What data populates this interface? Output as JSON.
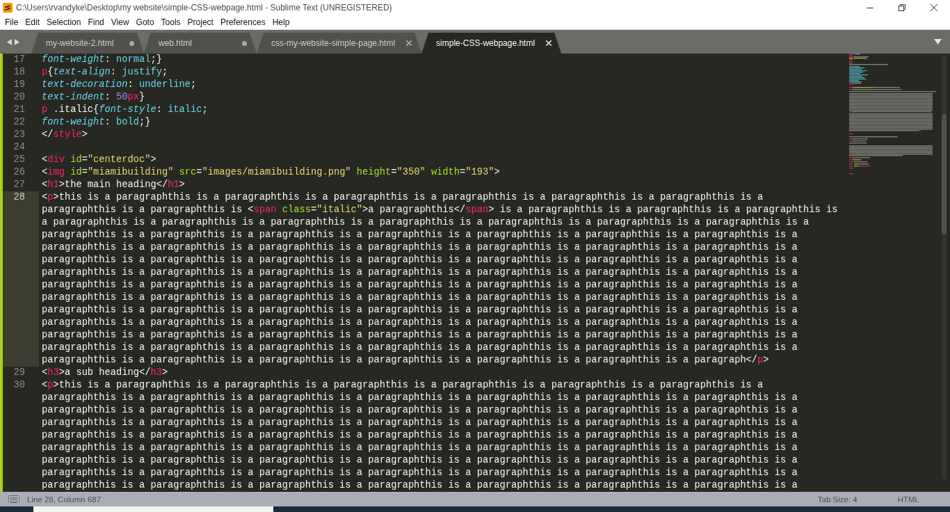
{
  "window": {
    "title": "C:\\Users\\rvandyke\\Desktop\\my website\\simple-CSS-webpage.html - Sublime Text (UNREGISTERED)"
  },
  "menu": [
    "File",
    "Edit",
    "Selection",
    "Find",
    "View",
    "Goto",
    "Tools",
    "Project",
    "Preferences",
    "Help"
  ],
  "tabs": [
    {
      "label": "my-website-2.html",
      "selected": false,
      "modified": true
    },
    {
      "label": "web.html",
      "selected": false,
      "modified": true
    },
    {
      "label": "css-my-website-simple-page.html",
      "selected": false,
      "modified": false
    },
    {
      "label": "simple-CSS-webpage.html",
      "selected": true,
      "modified": false
    }
  ],
  "editor": {
    "lines": [
      {
        "number": "17",
        "current": false,
        "wrapped": [
          {
            "spans": [
              {
                "kind": "property",
                "text": "font-weight"
              },
              {
                "kind": "plain",
                "text": ": "
              },
              {
                "kind": "value",
                "text": "normal"
              },
              {
                "kind": "plain",
                "text": ";}"
              }
            ]
          }
        ]
      },
      {
        "number": "18",
        "current": false,
        "wrapped": [
          {
            "spans": [
              {
                "kind": "tag",
                "text": "p"
              },
              {
                "kind": "plain",
                "text": "{"
              },
              {
                "kind": "property",
                "text": "text-align"
              },
              {
                "kind": "plain",
                "text": ": "
              },
              {
                "kind": "value",
                "text": "justify"
              },
              {
                "kind": "plain",
                "text": ";"
              }
            ]
          }
        ]
      },
      {
        "number": "19",
        "current": false,
        "wrapped": [
          {
            "spans": [
              {
                "kind": "property",
                "text": "text-decoration"
              },
              {
                "kind": "plain",
                "text": ": "
              },
              {
                "kind": "value",
                "text": "underline"
              },
              {
                "kind": "plain",
                "text": ";"
              }
            ]
          }
        ]
      },
      {
        "number": "20",
        "current": false,
        "wrapped": [
          {
            "spans": [
              {
                "kind": "property",
                "text": "text-indent"
              },
              {
                "kind": "plain",
                "text": ": "
              },
              {
                "kind": "number",
                "text": "50"
              },
              {
                "kind": "unit",
                "text": "px"
              },
              {
                "kind": "plain",
                "text": "}"
              }
            ]
          }
        ]
      },
      {
        "number": "21",
        "current": false,
        "wrapped": [
          {
            "spans": [
              {
                "kind": "tag",
                "text": "p"
              },
              {
                "kind": "plain",
                "text": " .italic{"
              },
              {
                "kind": "property",
                "text": "font-style"
              },
              {
                "kind": "plain",
                "text": ": "
              },
              {
                "kind": "value",
                "text": "italic"
              },
              {
                "kind": "plain",
                "text": ";"
              }
            ]
          }
        ]
      },
      {
        "number": "22",
        "current": false,
        "wrapped": [
          {
            "spans": [
              {
                "kind": "property",
                "text": "font-weight"
              },
              {
                "kind": "plain",
                "text": ": "
              },
              {
                "kind": "value",
                "text": "bold"
              },
              {
                "kind": "plain",
                "text": ";}"
              }
            ]
          }
        ]
      },
      {
        "number": "23",
        "current": false,
        "wrapped": [
          {
            "spans": [
              {
                "kind": "plain",
                "text": "</"
              },
              {
                "kind": "tag",
                "text": "style"
              },
              {
                "kind": "plain",
                "text": ">"
              }
            ]
          }
        ]
      },
      {
        "number": "24",
        "current": false
      },
      {
        "number": "25",
        "current": false,
        "wrapped": [
          {
            "spans": [
              {
                "kind": "plain",
                "text": "<"
              },
              {
                "kind": "tag",
                "text": "div"
              },
              {
                "kind": "attribute",
                "text": " id"
              },
              {
                "kind": "plain",
                "text": "="
              },
              {
                "kind": "string",
                "text": "\"centerdoc\""
              },
              {
                "kind": "plain",
                "text": ">"
              }
            ]
          }
        ]
      },
      {
        "number": "26",
        "current": false,
        "wrapped": [
          {
            "spans": [
              {
                "kind": "plain",
                "text": "<"
              },
              {
                "kind": "tag",
                "text": "img"
              },
              {
                "kind": "attribute",
                "text": " id"
              },
              {
                "kind": "plain",
                "text": "="
              },
              {
                "kind": "string",
                "text": "\"miamibuilding\""
              },
              {
                "kind": "attribute",
                "text": " src"
              },
              {
                "kind": "plain",
                "text": "="
              },
              {
                "kind": "string",
                "text": "\"images/miamibuilding.png\""
              },
              {
                "kind": "attribute",
                "text": " height"
              },
              {
                "kind": "plain",
                "text": "="
              },
              {
                "kind": "string",
                "text": "\"350\""
              },
              {
                "kind": "attribute",
                "text": " width"
              },
              {
                "kind": "plain",
                "text": "="
              },
              {
                "kind": "string",
                "text": "\"193\""
              },
              {
                "kind": "plain",
                "text": ">"
              }
            ]
          }
        ]
      },
      {
        "number": "27",
        "current": false,
        "wrapped": [
          {
            "spans": [
              {
                "kind": "plain",
                "text": "<"
              },
              {
                "kind": "tag",
                "text": "h1"
              },
              {
                "kind": "plain",
                "text": ">the main heading</"
              },
              {
                "kind": "tag",
                "text": "h1"
              },
              {
                "kind": "plain",
                "text": ">"
              }
            ]
          }
        ]
      },
      {
        "number": "28",
        "current": true,
        "wrapped": [
          {
            "spans": [
              {
                "kind": "plain",
                "text": "<"
              },
              {
                "kind": "tag",
                "text": "p"
              },
              {
                "kind": "plain",
                "text": ">this is a paragraphthis is a paragraphthis is a paragraphthis is a paragraphthis is a paragraphthis is a paragraphthis is a"
              }
            ]
          },
          {
            "spans": [
              {
                "kind": "plain",
                "text": "paragraphthis is a paragraphthis is <"
              },
              {
                "kind": "tag",
                "text": "span"
              },
              {
                "kind": "attribute",
                "text": " class"
              },
              {
                "kind": "plain",
                "text": "="
              },
              {
                "kind": "string",
                "text": "\"italic\""
              },
              {
                "kind": "plain",
                "text": ">a paragraphthis</"
              },
              {
                "kind": "tag",
                "text": "span"
              },
              {
                "kind": "plain",
                "text": "> is a paragraphthis is a paragraphthis is a paragraphthis is"
              }
            ]
          },
          {
            "spans": [
              {
                "kind": "plain",
                "text": "a paragraphthis is a paragraphthis is a paragraphthis is a paragraphthis is a paragraphthis is a paragraphthis is a paragraphthis is a"
              }
            ]
          },
          {
            "spans": [
              {
                "kind": "plain",
                "text": "paragraphthis is a paragraphthis is a paragraphthis is a paragraphthis is a paragraphthis is a paragraphthis is a paragraphthis is a"
              }
            ]
          },
          {
            "spans": [
              {
                "kind": "plain",
                "text": "paragraphthis is a paragraphthis is a paragraphthis is a paragraphthis is a paragraphthis is a paragraphthis is a paragraphthis is a"
              }
            ]
          },
          {
            "spans": [
              {
                "kind": "plain",
                "text": "paragraphthis is a paragraphthis is a paragraphthis is a paragraphthis is a paragraphthis is a paragraphthis is a paragraphthis is a"
              }
            ]
          },
          {
            "spans": [
              {
                "kind": "plain",
                "text": "paragraphthis is a paragraphthis is a paragraphthis is a paragraphthis is a paragraphthis is a paragraphthis is a paragraphthis is a"
              }
            ]
          },
          {
            "spans": [
              {
                "kind": "plain",
                "text": "paragraphthis is a paragraphthis is a paragraphthis is a paragraphthis is a paragraphthis is a paragraphthis is a paragraphthis is a"
              }
            ]
          },
          {
            "spans": [
              {
                "kind": "plain",
                "text": "paragraphthis is a paragraphthis is a paragraphthis is a paragraphthis is a paragraphthis is a paragraphthis is a paragraphthis is a"
              }
            ]
          },
          {
            "spans": [
              {
                "kind": "plain",
                "text": "paragraphthis is a paragraphthis is a paragraphthis is a paragraphthis is a paragraphthis is a paragraphthis is a paragraphthis is a"
              }
            ]
          },
          {
            "spans": [
              {
                "kind": "plain",
                "text": "paragraphthis is a paragraphthis is a paragraphthis is a paragraphthis is a paragraphthis is a paragraphthis is a paragraphthis is a"
              }
            ]
          },
          {
            "spans": [
              {
                "kind": "plain",
                "text": "paragraphthis is a paragraphthis is a paragraphthis is a paragraphthis is a paragraphthis is a paragraphthis is a paragraphthis is a"
              }
            ]
          },
          {
            "spans": [
              {
                "kind": "plain",
                "text": "paragraphthis is a paragraphthis is a paragraphthis is a paragraphthis is a paragraphthis is a paragraphthis is a paragraphthis is a"
              }
            ]
          },
          {
            "spans": [
              {
                "kind": "plain",
                "text": "paragraphthis is a paragraphthis is a paragraphthis is a paragraphthis is a paragraphthis is a paragraphthis is a paragraph</"
              },
              {
                "kind": "tag",
                "text": "p"
              },
              {
                "kind": "plain",
                "text": ">"
              }
            ]
          }
        ]
      },
      {
        "number": "29",
        "current": false,
        "wrapped": [
          {
            "spans": [
              {
                "kind": "plain",
                "text": "<"
              },
              {
                "kind": "tag",
                "text": "h3"
              },
              {
                "kind": "plain",
                "text": ">a sub heading</"
              },
              {
                "kind": "tag",
                "text": "h3"
              },
              {
                "kind": "plain",
                "text": ">"
              }
            ]
          }
        ]
      },
      {
        "number": "30",
        "current": false,
        "wrapped": [
          {
            "spans": [
              {
                "kind": "plain",
                "text": "<"
              },
              {
                "kind": "tag",
                "text": "p"
              },
              {
                "kind": "plain",
                "text": ">this is a paragraphthis is a paragraphthis is a paragraphthis is a paragraphthis is a paragraphthis is a paragraphthis is a"
              }
            ]
          },
          {
            "spans": [
              {
                "kind": "plain",
                "text": "paragraphthis is a paragraphthis is a paragraphthis is a paragraphthis is a paragraphthis is a paragraphthis is a paragraphthis is a"
              }
            ]
          },
          {
            "spans": [
              {
                "kind": "plain",
                "text": "paragraphthis is a paragraphthis is a paragraphthis is a paragraphthis is a paragraphthis is a paragraphthis is a paragraphthis is a"
              }
            ]
          },
          {
            "spans": [
              {
                "kind": "plain",
                "text": "paragraphthis is a paragraphthis is a paragraphthis is a paragraphthis is a paragraphthis is a paragraphthis is a paragraphthis is a"
              }
            ]
          },
          {
            "spans": [
              {
                "kind": "plain",
                "text": "paragraphthis is a paragraphthis is a paragraphthis is a paragraphthis is a paragraphthis is a paragraphthis is a paragraphthis is a"
              }
            ]
          },
          {
            "spans": [
              {
                "kind": "plain",
                "text": "paragraphthis is a paragraphthis is a paragraphthis is a paragraphthis is a paragraphthis is a paragraphthis is a paragraphthis is a"
              }
            ]
          },
          {
            "spans": [
              {
                "kind": "plain",
                "text": "paragraphthis is a paragraphthis is a paragraphthis is a paragraphthis is a paragraphthis is a paragraphthis is a paragraphthis is a"
              }
            ]
          },
          {
            "spans": [
              {
                "kind": "plain",
                "text": "paragraphthis is a paragraphthis is a paragraphthis is a paragraphthis is a paragraphthis is a paragraphthis is a paragraphthis is a"
              }
            ]
          },
          {
            "spans": [
              {
                "kind": "plain",
                "text": "paragraphthis is a paragraphthis is a paragraphthis is a paragraphthis is a paragraphthis is a paragraphthis is a paragraphthis is a"
              }
            ]
          }
        ]
      }
    ]
  },
  "status_bar": {
    "position": "Line 28, Column 687",
    "tab_size": "Tab Size: 4",
    "syntax": "HTML"
  }
}
